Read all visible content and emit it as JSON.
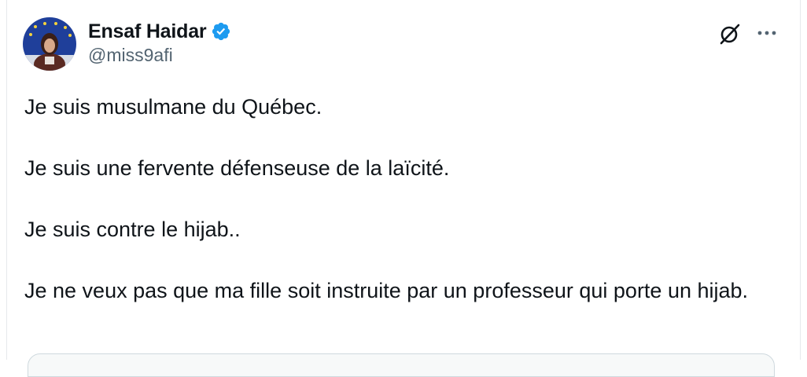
{
  "tweet": {
    "author": {
      "display_name": "Ensaf Haidar",
      "handle": "@miss9afi",
      "verified": true,
      "avatar_icon": "profile-photo"
    },
    "actions": {
      "grok_icon": "grok-icon",
      "more_icon": "more-icon"
    },
    "paragraphs": [
      "Je suis musulmane du Québec.",
      "Je suis une fervente défenseuse de la laïcité.",
      "Je suis contre le hijab..",
      "Je ne veux pas que ma fille soit instruite par un professeur qui porte un hijab."
    ]
  },
  "colors": {
    "verified_blue": "#1d9bf0",
    "text_primary": "#0f1419",
    "text_secondary": "#536471"
  }
}
